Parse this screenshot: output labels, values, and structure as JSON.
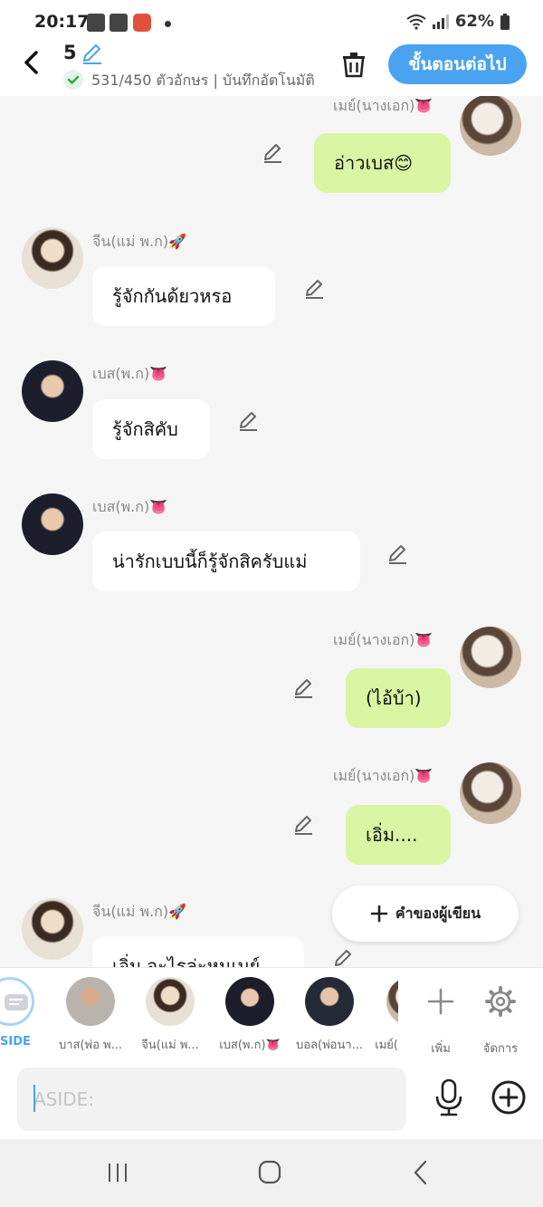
{
  "status": {
    "time": "20:17",
    "battery": "62%"
  },
  "header": {
    "title": "5",
    "saved_status": "531/450 ตัวอักษร | บันทึกอัตโนมัติ",
    "next_label": "ขั้นตอนต่อไป"
  },
  "messages": [
    {
      "sender": "เมย์(นางเอก)👅",
      "text": "อ่าวเบส😊",
      "side": "right"
    },
    {
      "sender": "จีน(แม่ พ.ก)🚀",
      "text": "รู้จักกันด้ยวหรอ",
      "side": "left"
    },
    {
      "sender": "เบส(พ.ก)👅",
      "text": "รู้จักสิคับ",
      "side": "left"
    },
    {
      "sender": "เบส(พ.ก)👅",
      "text": "น่ารักเบบนี้ก็รู้จักสิครับแม่",
      "side": "left"
    },
    {
      "sender": "เมย์(นางเอก)👅",
      "text": "(ไอ้บ้า)",
      "side": "right"
    },
    {
      "sender": "เมย์(นางเอก)👅",
      "text": "เอิ่ม....",
      "side": "right"
    },
    {
      "sender": "จีน(แม่ พ.ก)🚀",
      "text": "เอิ่ม จะไรล่ะหนูเมย์",
      "side": "left"
    }
  ],
  "fab_label": "คำของผู้เขียน",
  "aside_label": "SIDE",
  "characters": [
    {
      "label": "บาส(พ่อ พ..."
    },
    {
      "label": "จีน(แม่ พ..."
    },
    {
      "label": "เบส(พ.ก)👅"
    },
    {
      "label": "บอล(พ่อนา..."
    },
    {
      "label": "เมย์("
    }
  ],
  "controls": {
    "add_label": "เพิ่ม",
    "manage_label": "จัดการ"
  },
  "input": {
    "placeholder": "ASIDE:"
  },
  "colors": {
    "accent": "#4aa3f0",
    "my_bubble": "#d9f5a3",
    "other_bubble": "#ffffff"
  }
}
